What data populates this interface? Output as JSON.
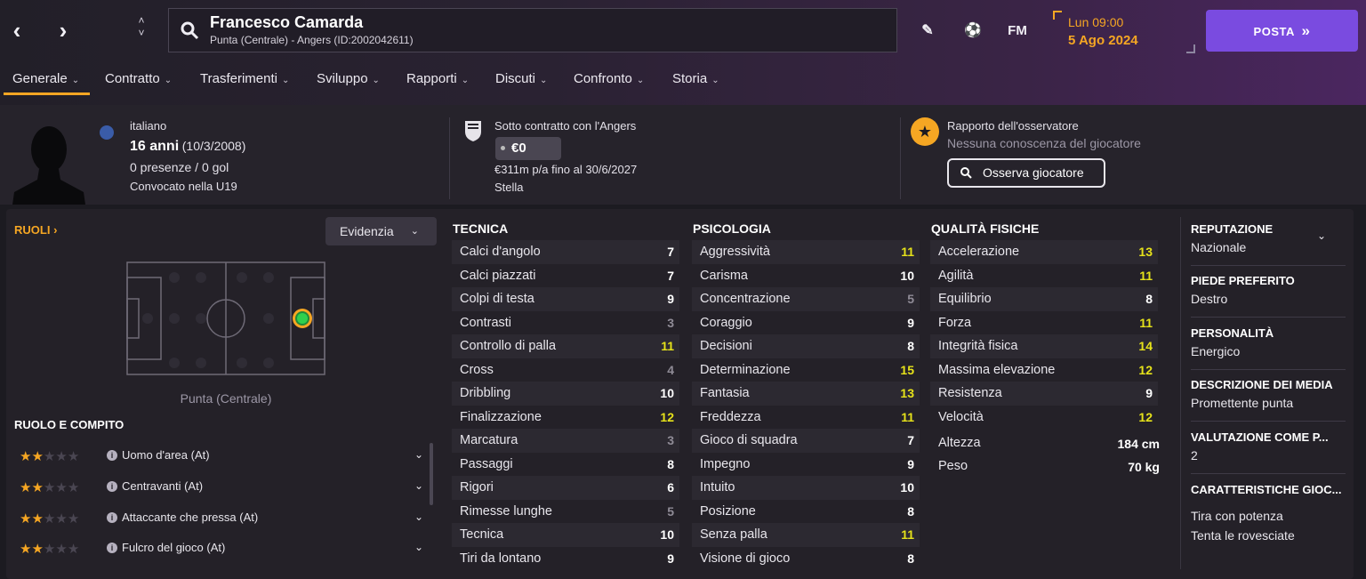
{
  "header": {
    "player_name": "Francesco Camarda",
    "player_sub": "Punta (Centrale) - Angers (ID:2002042611)",
    "fm_label": "FM",
    "date_line1": "Lun 09:00",
    "date_line2": "5 Ago 2024",
    "continue_label": "POSTA",
    "continue_arrow": "»"
  },
  "tabs": [
    "Generale",
    "Contratto",
    "Trasferimenti",
    "Sviluppo",
    "Rapporti",
    "Discuti",
    "Confronto",
    "Storia"
  ],
  "info": {
    "nationality": "italiano",
    "age": "16 anni",
    "dob": "(10/3/2008)",
    "apps": "0 presenze / 0 gol",
    "called": "Convocato nella U19",
    "contract_title": "Sotto contratto con l'Angers",
    "value": "€0",
    "wage": "€311m p/a fino al 30/6/2027",
    "status": "Stella",
    "scout_title": "Rapporto dell'osservatore",
    "scout_sub": "Nessuna conoscenza del giocatore",
    "scout_button": "Osserva giocatore"
  },
  "roles": {
    "title": "RUOLI",
    "highlight": "Evidenzia",
    "position_label": "Punta (Centrale)",
    "role_title": "RUOLO E COMPITO",
    "items": [
      {
        "name": "Uomo d'area (At)",
        "stars": 2
      },
      {
        "name": "Centravanti (At)",
        "stars": 2
      },
      {
        "name": "Attaccante che pressa (At)",
        "stars": 2
      },
      {
        "name": "Fulcro del gioco (At)",
        "stars": 2
      }
    ]
  },
  "technical": {
    "title": "TECNICA",
    "attrs": [
      {
        "name": "Calci d'angolo",
        "value": "7",
        "tone": "w"
      },
      {
        "name": "Calci piazzati",
        "value": "7",
        "tone": "w"
      },
      {
        "name": "Colpi di testa",
        "value": "9",
        "tone": "w"
      },
      {
        "name": "Contrasti",
        "value": "3",
        "tone": "g"
      },
      {
        "name": "Controllo di palla",
        "value": "11",
        "tone": "y"
      },
      {
        "name": "Cross",
        "value": "4",
        "tone": "g"
      },
      {
        "name": "Dribbling",
        "value": "10",
        "tone": "w"
      },
      {
        "name": "Finalizzazione",
        "value": "12",
        "tone": "y"
      },
      {
        "name": "Marcatura",
        "value": "3",
        "tone": "g"
      },
      {
        "name": "Passaggi",
        "value": "8",
        "tone": "w"
      },
      {
        "name": "Rigori",
        "value": "6",
        "tone": "w"
      },
      {
        "name": "Rimesse lunghe",
        "value": "5",
        "tone": "g"
      },
      {
        "name": "Tecnica",
        "value": "10",
        "tone": "w"
      },
      {
        "name": "Tiri da lontano",
        "value": "9",
        "tone": "w"
      }
    ]
  },
  "mental": {
    "title": "PSICOLOGIA",
    "attrs": [
      {
        "name": "Aggressività",
        "value": "11",
        "tone": "y"
      },
      {
        "name": "Carisma",
        "value": "10",
        "tone": "w"
      },
      {
        "name": "Concentrazione",
        "value": "5",
        "tone": "g"
      },
      {
        "name": "Coraggio",
        "value": "9",
        "tone": "w"
      },
      {
        "name": "Decisioni",
        "value": "8",
        "tone": "w"
      },
      {
        "name": "Determinazione",
        "value": "15",
        "tone": "y"
      },
      {
        "name": "Fantasia",
        "value": "13",
        "tone": "y"
      },
      {
        "name": "Freddezza",
        "value": "11",
        "tone": "y"
      },
      {
        "name": "Gioco di squadra",
        "value": "7",
        "tone": "w"
      },
      {
        "name": "Impegno",
        "value": "9",
        "tone": "w"
      },
      {
        "name": "Intuito",
        "value": "10",
        "tone": "w"
      },
      {
        "name": "Posizione",
        "value": "8",
        "tone": "w"
      },
      {
        "name": "Senza palla",
        "value": "11",
        "tone": "y"
      },
      {
        "name": "Visione di gioco",
        "value": "8",
        "tone": "w"
      }
    ]
  },
  "physical": {
    "title": "QUALITÀ FISICHE",
    "attrs": [
      {
        "name": "Accelerazione",
        "value": "13",
        "tone": "y"
      },
      {
        "name": "Agilità",
        "value": "11",
        "tone": "y"
      },
      {
        "name": "Equilibrio",
        "value": "8",
        "tone": "w"
      },
      {
        "name": "Forza",
        "value": "11",
        "tone": "y"
      },
      {
        "name": "Integrità fisica",
        "value": "14",
        "tone": "y"
      },
      {
        "name": "Massima elevazione",
        "value": "12",
        "tone": "y"
      },
      {
        "name": "Resistenza",
        "value": "9",
        "tone": "w"
      },
      {
        "name": "Velocità",
        "value": "12",
        "tone": "y"
      }
    ],
    "height_label": "Altezza",
    "height": "184 cm",
    "weight_label": "Peso",
    "weight": "70 kg"
  },
  "side": {
    "reputation_h": "REPUTAZIONE",
    "reputation": "Nazionale",
    "foot_h": "PIEDE PREFERITO",
    "foot": "Destro",
    "personality_h": "PERSONALITÀ",
    "personality": "Energico",
    "media_h": "DESCRIZIONE DEI MEDIA",
    "media": "Promettente punta",
    "rating_h": "VALUTAZIONE COME P...",
    "rating": "2",
    "traits_h": "CARATTERISTICHE GIOC...",
    "trait1": "Tira con potenza",
    "trait2": "Tenta le rovesciate"
  },
  "colors": {
    "accent": "#f5a623",
    "button": "#7a4be0",
    "good": "#e6e21a",
    "weak": "#8f8b96"
  }
}
